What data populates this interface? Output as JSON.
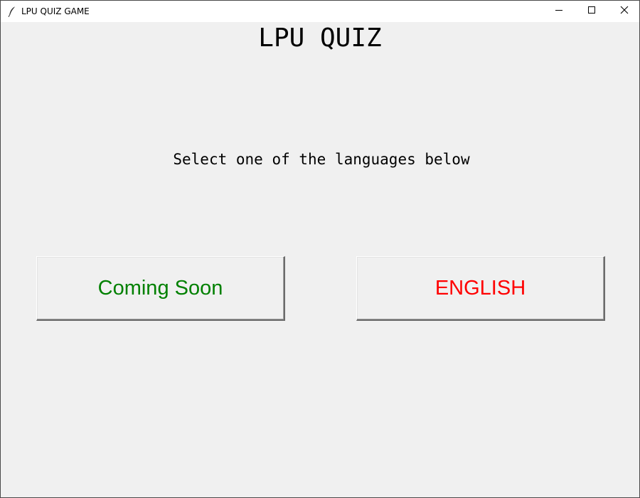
{
  "window": {
    "title": "LPU QUIZ GAME",
    "app_icon": "feather-icon",
    "controls": [
      "minimize-icon",
      "maximize-icon",
      "close-icon"
    ]
  },
  "main": {
    "heading": "LPU QUIZ",
    "subtitle": "Select one of the languages below",
    "buttons": [
      {
        "label": "Coming Soon",
        "color": "#008000"
      },
      {
        "label": "ENGLISH",
        "color": "#ff0000"
      }
    ]
  },
  "colors": {
    "background": "#f0f0f0",
    "titlebar": "#ffffff"
  }
}
